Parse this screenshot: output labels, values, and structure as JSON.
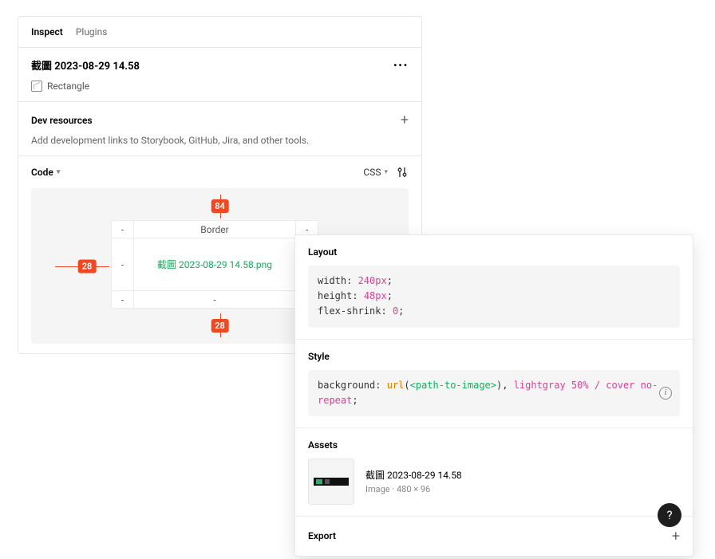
{
  "tabs": {
    "inspect": "Inspect",
    "plugins": "Plugins"
  },
  "layer": {
    "title": "截圖 2023-08-29 14.58",
    "type": "Rectangle"
  },
  "dev": {
    "title": "Dev resources",
    "desc": "Add development links to Storybook, GitHub, Jira, and other tools."
  },
  "code": {
    "label": "Code",
    "lang": "CSS"
  },
  "inspector": {
    "top_gap": "84",
    "bottom_gap": "28",
    "left_gap": "28",
    "border_label": "Border",
    "filename": "截圖 2023-08-29 14.58.png"
  },
  "layout": {
    "label": "Layout",
    "width_prop": "width",
    "width_val": "240px",
    "height_prop": "height",
    "height_val": "48px",
    "flex_prop": "flex-shrink",
    "flex_val": "0"
  },
  "style": {
    "label": "Style",
    "bg_prop": "background",
    "url_func": "url",
    "url_arg": "<path-to-image>",
    "rest": "lightgray 50% / cover no-repeat"
  },
  "assets": {
    "label": "Assets",
    "name": "截圖 2023-08-29 14.58",
    "meta": "Image · 480 × 96"
  },
  "export": {
    "label": "Export"
  },
  "help": "?"
}
